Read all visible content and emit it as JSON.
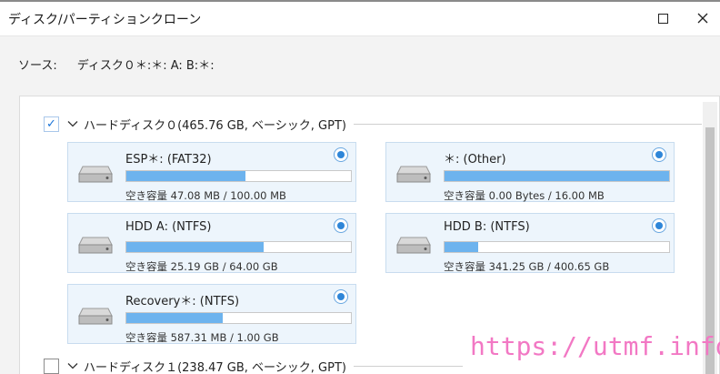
{
  "window": {
    "title": "ディスク/パーティションクローン"
  },
  "source": {
    "label": "ソース:",
    "value": "ディスク０＊:＊: A: B:＊:"
  },
  "disks": [
    {
      "checked": true,
      "check_mark": "✓",
      "label": "ハードディスク０(465.76 GB, ベーシック, GPT)",
      "partitions": [
        {
          "name": "ESP＊: (FAT32)",
          "free": "空き容量 47.08 MB / 100.00 MB",
          "used_fraction": 0.53,
          "selected": true
        },
        {
          "name": "＊: (Other)",
          "free": "空き容量 0.00 Bytes / 16.00 MB",
          "used_fraction": 1.0,
          "selected": true
        },
        {
          "name": "HDD A: (NTFS)",
          "free": "空き容量 25.19 GB / 64.00 GB",
          "used_fraction": 0.61,
          "selected": true
        },
        {
          "name": "HDD B: (NTFS)",
          "free": "空き容量 341.25 GB / 400.65 GB",
          "used_fraction": 0.15,
          "selected": true
        },
        {
          "name": "Recovery＊: (NTFS)",
          "free": "空き容量 587.31 MB / 1.00 GB",
          "used_fraction": 0.43,
          "selected": true
        }
      ]
    },
    {
      "checked": false,
      "check_mark": "",
      "label": "ハードディスク１(238.47 GB, ベーシック, GPT)"
    }
  ],
  "watermark": "https://utmf.info/",
  "icons": {
    "maximize": "maximize-icon",
    "close": "close-icon",
    "chevron": "chevron-down-icon",
    "drive": "hard-drive-icon"
  },
  "colors": {
    "bar_fill": "#6db3ee",
    "card_bg": "#edf5fc",
    "radio": "#2f86d8",
    "watermark": "#f278c4"
  }
}
